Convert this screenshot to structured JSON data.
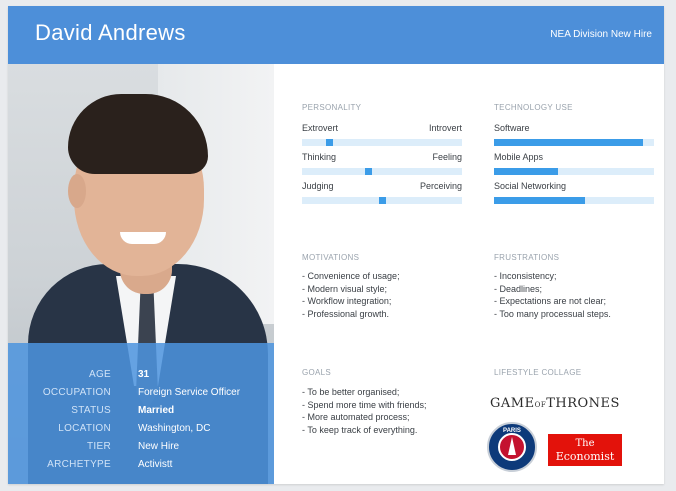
{
  "header": {
    "name": "David Andrews",
    "subtitle": "NEA Division New Hire",
    "color": "#4d8fd9"
  },
  "profile": [
    {
      "label": "AGE",
      "value": "31",
      "bold": true
    },
    {
      "label": "OCCUPATION",
      "value": "Foreign Service Officer",
      "bold": false
    },
    {
      "label": "STATUS",
      "value": "Married",
      "bold": true
    },
    {
      "label": "LOCATION",
      "value": "Washington, DC",
      "bold": false
    },
    {
      "label": "TIER",
      "value": "New Hire",
      "bold": false
    },
    {
      "label": "ARCHETYPE",
      "value": "Activistt",
      "bold": false
    }
  ],
  "personality": {
    "title": "PERSONALITY",
    "traits": [
      {
        "left": "Extrovert",
        "right": "Introvert",
        "level": 0.16
      },
      {
        "left": "Thinking",
        "right": "Feeling",
        "level": 0.41
      },
      {
        "left": "Judging",
        "right": "Perceiving",
        "level": 0.5
      }
    ]
  },
  "technology": {
    "title": "TECHNOLOGY USE",
    "items": [
      {
        "label": "Software",
        "level": 0.93
      },
      {
        "label": "Mobile Apps",
        "level": 0.4
      },
      {
        "label": "Social Networking",
        "level": 0.57
      }
    ]
  },
  "motivations": {
    "title": "MOTIVATIONS",
    "items": [
      "- Convenience of usage;",
      "- Modern visual style;",
      "- Workflow integration;",
      "- Professional growth."
    ]
  },
  "frustrations": {
    "title": "FRUSTRATIONS",
    "items": [
      "- Inconsistency;",
      "- Deadlines;",
      "- Expectations are not clear;",
      "- Too many processual steps."
    ]
  },
  "goals": {
    "title": "GOALS",
    "items": [
      "- To be better organised;",
      "- Spend more time with friends;",
      "- More automated process;",
      "- To keep track of everything."
    ]
  },
  "lifestyle": {
    "title": "LIFESTYLE COLLAGE",
    "got_left": "GAME",
    "got_of": "OF",
    "got_right": "THRONES",
    "psg": "PARIS",
    "econ_l1": "The",
    "econ_l2": "Economist"
  },
  "colors": {
    "accent": "#3b9ce8",
    "track": "#dcedfa",
    "economist": "#e3120b"
  }
}
